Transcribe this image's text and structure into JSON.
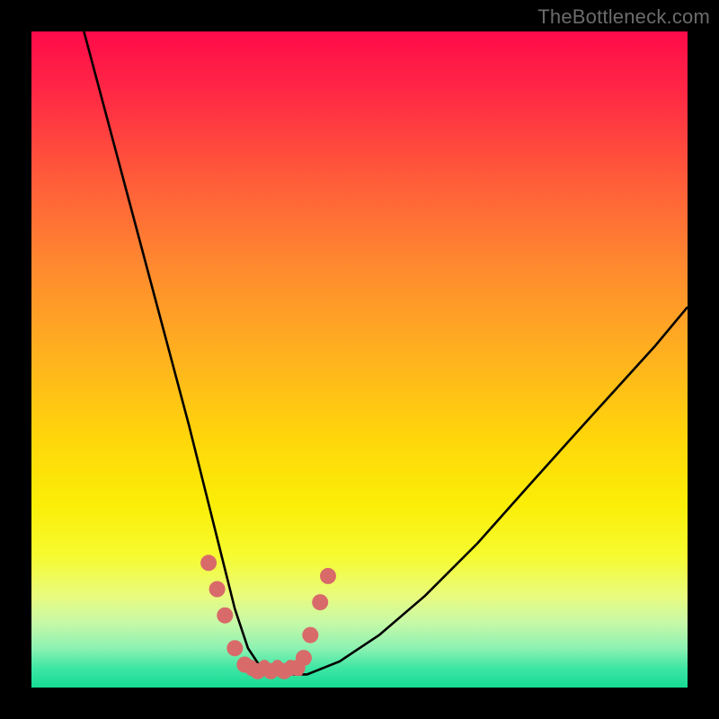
{
  "watermark": {
    "text": "TheBottleneck.com"
  },
  "chart_data": {
    "type": "line",
    "title": "",
    "xlabel": "",
    "ylabel": "",
    "xlim": [
      0,
      100
    ],
    "ylim": [
      0,
      100
    ],
    "grid": false,
    "legend": false,
    "series": [
      {
        "name": "bottleneck-curve",
        "x": [
          8,
          12,
          16,
          20,
          24,
          27,
          29,
          31,
          33,
          35,
          37,
          42,
          47,
          53,
          60,
          68,
          76,
          85,
          95,
          100
        ],
        "values": [
          100,
          85,
          70,
          55,
          40,
          28,
          20,
          12,
          6,
          3,
          2,
          2,
          4,
          8,
          14,
          22,
          31,
          41,
          52,
          58
        ]
      },
      {
        "name": "data-points-overlay",
        "x": [
          27.0,
          28.3,
          29.5,
          31.0,
          32.5,
          34.5,
          36.5,
          38.5,
          40.5,
          41.5,
          42.5,
          44.0,
          45.2
        ],
        "values": [
          19.0,
          15.0,
          11.0,
          6.0,
          3.5,
          2.5,
          2.5,
          2.5,
          3.0,
          4.5,
          8.0,
          13.0,
          17.0
        ]
      }
    ],
    "gradient_stops": [
      {
        "pos": 0,
        "color": "#ff0a4a"
      },
      {
        "pos": 10,
        "color": "#ff2b44"
      },
      {
        "pos": 22,
        "color": "#ff5a3a"
      },
      {
        "pos": 36,
        "color": "#ff8a2f"
      },
      {
        "pos": 50,
        "color": "#ffb31e"
      },
      {
        "pos": 62,
        "color": "#ffd60a"
      },
      {
        "pos": 72,
        "color": "#fbee07"
      },
      {
        "pos": 80,
        "color": "#f6fb30"
      },
      {
        "pos": 86,
        "color": "#e9fb7e"
      },
      {
        "pos": 90,
        "color": "#c8f9a7"
      },
      {
        "pos": 94,
        "color": "#8df2b2"
      },
      {
        "pos": 97,
        "color": "#3fe6a4"
      },
      {
        "pos": 100,
        "color": "#16db93"
      }
    ],
    "colors": {
      "curve_stroke": "#000000",
      "point_fill": "#d96a6a",
      "frame": "#000000"
    }
  }
}
